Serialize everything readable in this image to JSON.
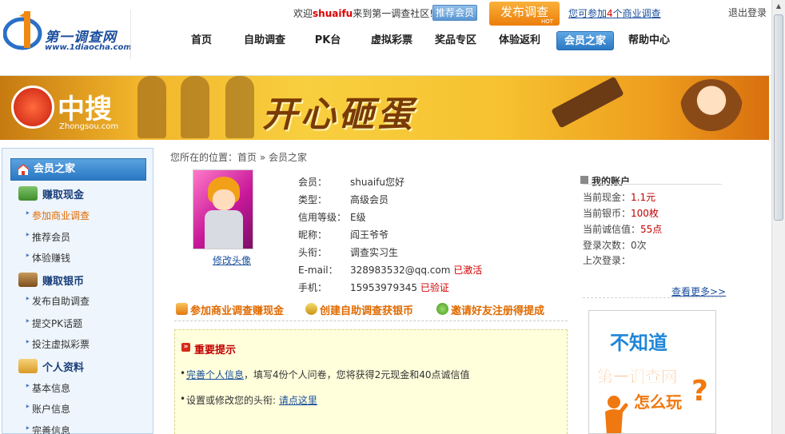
{
  "header": {
    "logo_title": "第一调查网",
    "logo_url": "www.1diaocha.com",
    "welcome_prefix": "欢迎",
    "username": "shuaifu",
    "welcome_suffix": "来到第一调查社区!",
    "recommend_button": "推荐会员",
    "publish_button": "发布调查",
    "publish_badge": "HOT",
    "business_prefix": "您可参加",
    "business_count": "4",
    "business_suffix": "个商业调查",
    "logout": "退出登录",
    "nav": [
      "首页",
      "自助调查",
      "PK台",
      "虚拟彩票",
      "奖品专区",
      "体验返利",
      "会员之家",
      "帮助中心"
    ],
    "nav_active": "会员之家"
  },
  "banner": {
    "brand_cn": "中搜",
    "brand_en": "Zhongsou.com",
    "slogan": "开心砸蛋"
  },
  "sidebar": {
    "title": "会员之家",
    "sections": [
      {
        "title": "赚取现金",
        "icon": "cash-icon",
        "items": [
          "参加商业调查",
          "推荐会员",
          "体验赚钱"
        ]
      },
      {
        "title": "赚取银币",
        "icon": "silver-coin-icon",
        "items": [
          "发布自助调查",
          "提交PK话题",
          "投注虚拟彩票"
        ]
      },
      {
        "title": "个人资料",
        "icon": "profile-icon",
        "items": [
          "基本信息",
          "账户信息",
          "完善信息"
        ]
      }
    ],
    "current_item": "参加商业调查"
  },
  "breadcrumb": {
    "prefix": "您所在的位置：",
    "home": "首页",
    "separator": "»",
    "current": "会员之家"
  },
  "profile": {
    "edit_avatar": "修改头像",
    "rows": [
      {
        "label": "会员：",
        "value": "shuaifu您好"
      },
      {
        "label": "类型：",
        "value": "高级会员"
      },
      {
        "label": "信用等级：",
        "value": "E级"
      },
      {
        "label": "昵称：",
        "value": "阎王爷爷"
      },
      {
        "label": "头衔：",
        "value": "调查实习生"
      },
      {
        "label": "E-mail：",
        "value": "328983532@qq.com",
        "status": "已激活"
      },
      {
        "label": "手机：",
        "value": "15953979345",
        "status": "已验证"
      }
    ]
  },
  "actions": [
    {
      "label": "参加商业调查赚现金",
      "icon": "survey-pen-icon"
    },
    {
      "label": "创建自助调查获银币",
      "icon": "coin-bag-icon"
    },
    {
      "label": "邀请好友注册得提成",
      "icon": "refresh-arrows-icon"
    }
  ],
  "notice": {
    "title": "重要提示",
    "line1_link": "完善个人信息",
    "line1_text": "，填写4份个人问卷，您将获得2元现金和40点诚信值",
    "line2_text": "设置或修改您的头衔: ",
    "line2_link": "请点这里"
  },
  "account": {
    "title": "我的账户",
    "rows": [
      {
        "label": "当前现金：",
        "value": "1.1元"
      },
      {
        "label": "当前银币：",
        "value": "100枚"
      },
      {
        "label": "当前诚信值：",
        "value": "55点"
      },
      {
        "label": "登录次数：",
        "value": "0次"
      },
      {
        "label": "上次登录：",
        "value": ""
      }
    ],
    "more": "查看更多>>"
  },
  "ad": {
    "line1": "不知道",
    "line2": "第一调查网",
    "line3": "怎么玩",
    "mark": "?"
  },
  "colors": {
    "nav_active": "#2a78c4",
    "accent_orange": "#e06a00",
    "alert_red": "#d40000",
    "link_blue": "#1a4f9c",
    "notice_bg": "#ffffdc"
  }
}
